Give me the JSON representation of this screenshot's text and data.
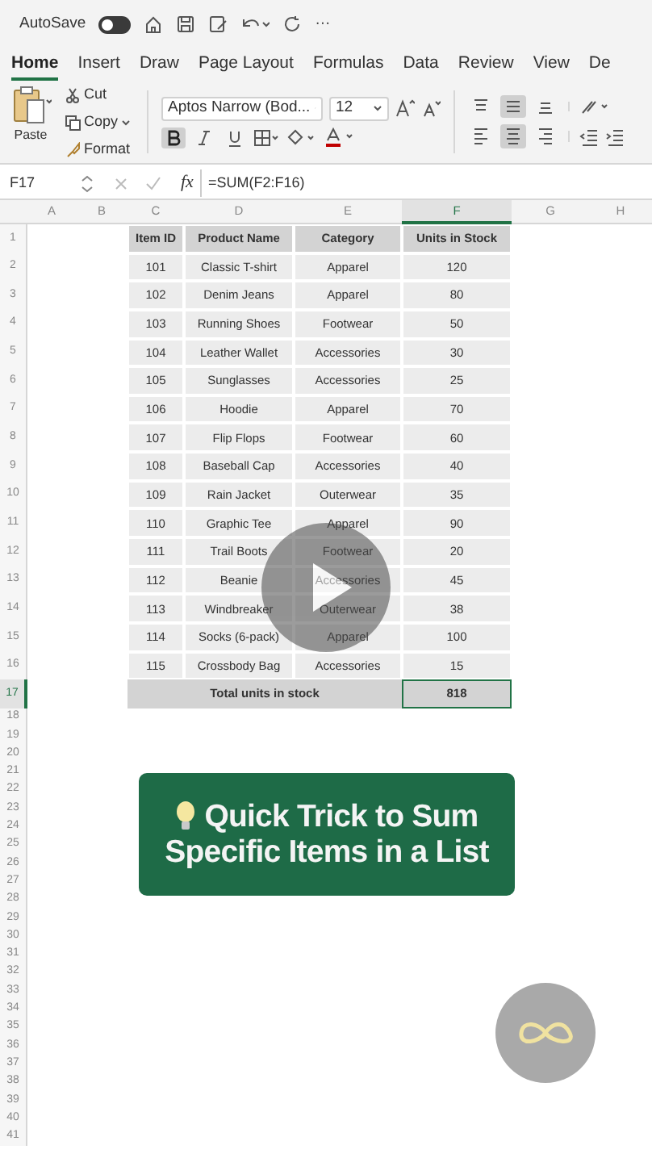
{
  "quick_access": {
    "autosave_label": "AutoSave",
    "autosave_on": false,
    "more": "···"
  },
  "ribbon_tabs": [
    {
      "label": "Home",
      "selected": true
    },
    {
      "label": "Insert",
      "selected": false
    },
    {
      "label": "Draw",
      "selected": false
    },
    {
      "label": "Page Layout",
      "selected": false
    },
    {
      "label": "Formulas",
      "selected": false
    },
    {
      "label": "Data",
      "selected": false
    },
    {
      "label": "Review",
      "selected": false
    },
    {
      "label": "View",
      "selected": false
    },
    {
      "label": "De",
      "selected": false
    }
  ],
  "clipboard": {
    "paste": "Paste",
    "cut": "Cut",
    "copy": "Copy",
    "format": "Format"
  },
  "font": {
    "name": "Aptos Narrow (Bod...",
    "size": "12",
    "bold_selected": true,
    "italic_selected": false,
    "underline_selected": false
  },
  "alignment": {
    "top_selected": [
      false,
      true,
      false
    ],
    "bottom_selected": [
      false,
      true,
      false
    ]
  },
  "formula_bar": {
    "name_box": "F17",
    "fx": "fx",
    "formula": "=SUM(F2:F16)"
  },
  "column_headers": [
    {
      "label": "A",
      "selected": false
    },
    {
      "label": "B",
      "selected": false
    },
    {
      "label": "C",
      "selected": false
    },
    {
      "label": "D",
      "selected": false
    },
    {
      "label": "E",
      "selected": false
    },
    {
      "label": "F",
      "selected": true
    },
    {
      "label": "G",
      "selected": false
    },
    {
      "label": "H",
      "selected": false
    }
  ],
  "row_numbers": [
    {
      "label": "1",
      "selected": false
    },
    {
      "label": "2",
      "selected": false
    },
    {
      "label": "3",
      "selected": false
    },
    {
      "label": "4",
      "selected": false
    },
    {
      "label": "5",
      "selected": false
    },
    {
      "label": "6",
      "selected": false
    },
    {
      "label": "7",
      "selected": false
    },
    {
      "label": "8",
      "selected": false
    },
    {
      "label": "9",
      "selected": false
    },
    {
      "label": "10",
      "selected": false
    },
    {
      "label": "11",
      "selected": false
    },
    {
      "label": "12",
      "selected": false
    },
    {
      "label": "13",
      "selected": false
    },
    {
      "label": "14",
      "selected": false
    },
    {
      "label": "15",
      "selected": false
    },
    {
      "label": "16",
      "selected": false
    },
    {
      "label": "17",
      "selected": true
    },
    {
      "label": "18",
      "selected": false
    },
    {
      "label": "19",
      "selected": false
    },
    {
      "label": "20",
      "selected": false
    },
    {
      "label": "21",
      "selected": false
    },
    {
      "label": "22",
      "selected": false
    },
    {
      "label": "23",
      "selected": false
    },
    {
      "label": "24",
      "selected": false
    },
    {
      "label": "25",
      "selected": false
    },
    {
      "label": "26",
      "selected": false
    },
    {
      "label": "27",
      "selected": false
    },
    {
      "label": "28",
      "selected": false
    },
    {
      "label": "29",
      "selected": false
    },
    {
      "label": "30",
      "selected": false
    },
    {
      "label": "31",
      "selected": false
    },
    {
      "label": "32",
      "selected": false
    },
    {
      "label": "33",
      "selected": false
    },
    {
      "label": "34",
      "selected": false
    },
    {
      "label": "35",
      "selected": false
    },
    {
      "label": "36",
      "selected": false
    },
    {
      "label": "37",
      "selected": false
    },
    {
      "label": "38",
      "selected": false
    },
    {
      "label": "39",
      "selected": false
    },
    {
      "label": "40",
      "selected": false
    },
    {
      "label": "41",
      "selected": false
    }
  ],
  "table": {
    "columns": [
      "Item ID",
      "Product Name",
      "Category",
      "Units in Stock"
    ],
    "rows": [
      [
        "101",
        "Classic T-shirt",
        "Apparel",
        "120"
      ],
      [
        "102",
        "Denim Jeans",
        "Apparel",
        "80"
      ],
      [
        "103",
        "Running Shoes",
        "Footwear",
        "50"
      ],
      [
        "104",
        "Leather Wallet",
        "Accessories",
        "30"
      ],
      [
        "105",
        "Sunglasses",
        "Accessories",
        "25"
      ],
      [
        "106",
        "Hoodie",
        "Apparel",
        "70"
      ],
      [
        "107",
        "Flip Flops",
        "Footwear",
        "60"
      ],
      [
        "108",
        "Baseball Cap",
        "Accessories",
        "40"
      ],
      [
        "109",
        "Rain Jacket",
        "Outerwear",
        "35"
      ],
      [
        "110",
        "Graphic Tee",
        "Apparel",
        "90"
      ],
      [
        "111",
        "Trail Boots",
        "Footwear",
        "20"
      ],
      [
        "112",
        "Beanie",
        "Accessories",
        "45"
      ],
      [
        "113",
        "Windbreaker",
        "Outerwear",
        "38"
      ],
      [
        "114",
        "Socks (6-pack)",
        "Apparel",
        "100"
      ],
      [
        "115",
        "Crossbody Bag",
        "Accessories",
        "15"
      ]
    ],
    "total_label": "Total units in stock",
    "total_value": "818",
    "total_selected": true
  },
  "banner": {
    "lines": [
      "Quick Trick to Sum",
      "Specific Items in a List"
    ]
  }
}
